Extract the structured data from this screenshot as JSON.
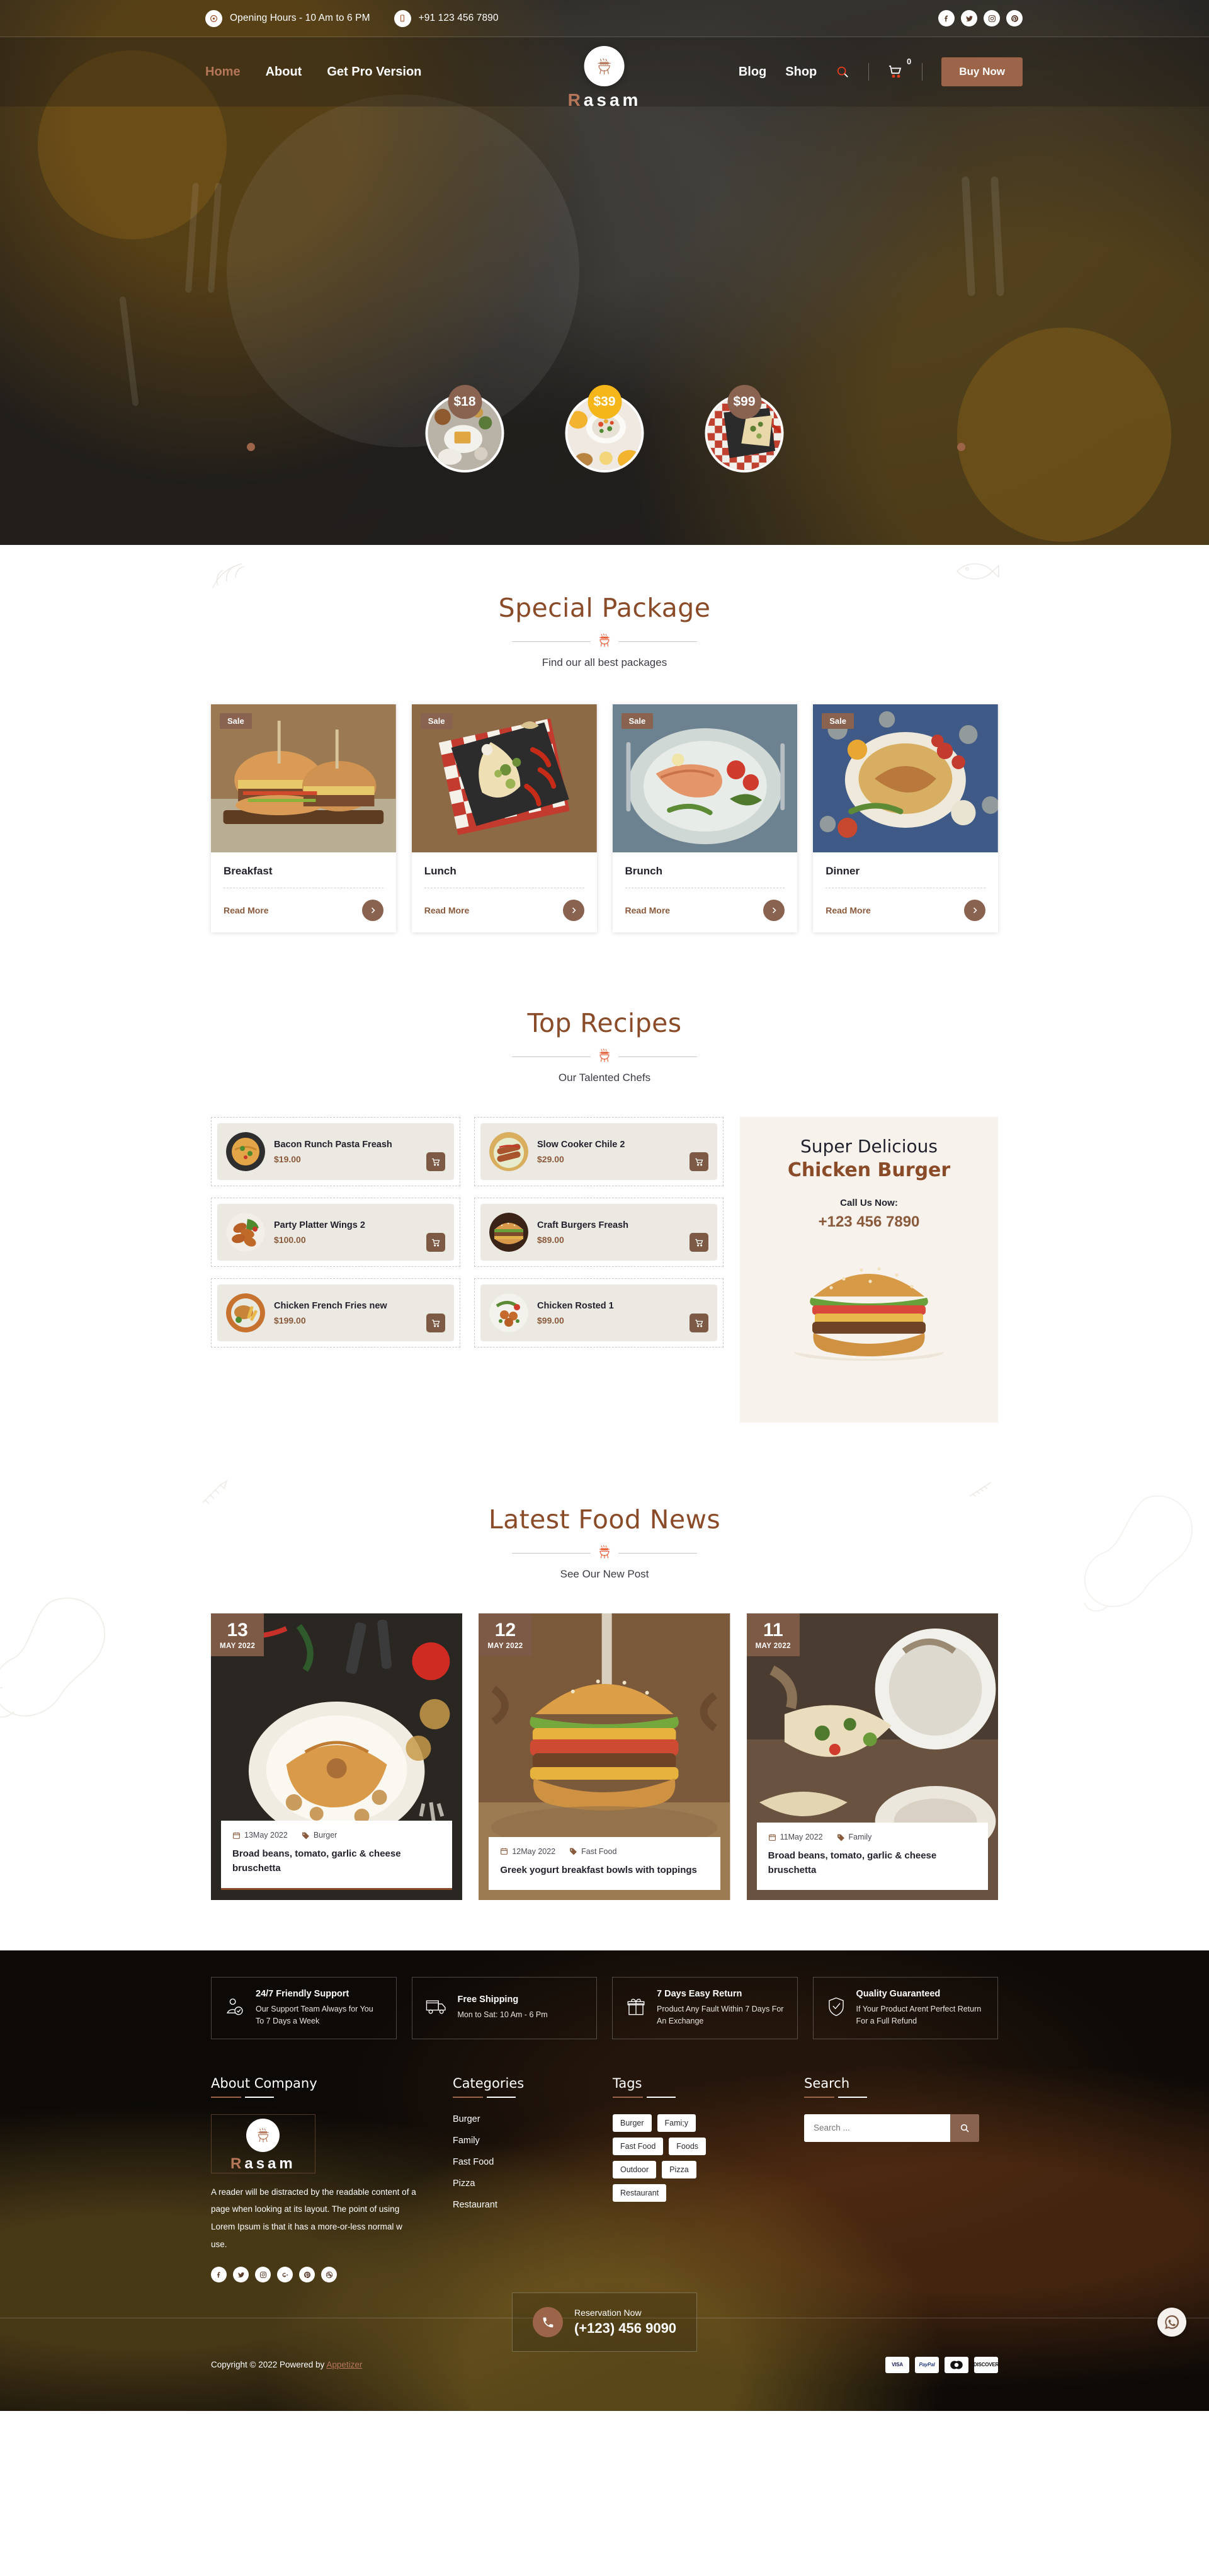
{
  "topbar": {
    "opening_hours": "Opening Hours - 10 Am to 6 PM",
    "phone": "+91 123 456 7890",
    "socials": [
      {
        "name": "facebook-icon",
        "label": "Facebook"
      },
      {
        "name": "twitter-icon",
        "label": "Twitter"
      },
      {
        "name": "instagram-icon",
        "label": "Instagram"
      },
      {
        "name": "pinterest-icon",
        "label": "Pinterest"
      }
    ]
  },
  "nav": {
    "left_links": [
      "Home",
      "About",
      "Get Pro Version"
    ],
    "right_links": [
      "Blog",
      "Shop"
    ],
    "cart_count": "0",
    "buy_now": "Buy Now",
    "brand": {
      "first_letter": "R",
      "rest": "asam",
      "full": "Rasam"
    }
  },
  "hero": {
    "circles": [
      {
        "price": "$18",
        "highlight": false
      },
      {
        "price": "$39",
        "highlight": true
      },
      {
        "price": "$99",
        "highlight": false
      }
    ]
  },
  "special": {
    "title": "Special Package",
    "subtitle": "Find our all best packages",
    "cards": [
      {
        "badge": "Sale",
        "title": "Breakfast",
        "link": "Read More"
      },
      {
        "badge": "Sale",
        "title": "Lunch",
        "link": "Read More"
      },
      {
        "badge": "Sale",
        "title": "Brunch",
        "link": "Read More"
      },
      {
        "badge": "Sale",
        "title": "Dinner",
        "link": "Read More"
      }
    ]
  },
  "recipes": {
    "title": "Top Recipes",
    "subtitle": "Our Talented Chefs",
    "items": [
      {
        "name": "Bacon Runch Pasta Freash",
        "price": "$19.00"
      },
      {
        "name": "Slow Cooker Chile 2",
        "price": "$29.00"
      },
      {
        "name": "Party Platter Wings 2",
        "price": "$100.00"
      },
      {
        "name": "Craft Burgers Freash",
        "price": "$89.00"
      },
      {
        "name": "Chicken French Fries new",
        "price": "$199.00"
      },
      {
        "name": "Chicken Rosted 1",
        "price": "$99.00"
      }
    ],
    "promo": {
      "line1": "Super Delicious",
      "line2": "Chicken Burger",
      "call_label": "Call Us Now:",
      "phone": "+123 456 7890"
    }
  },
  "news": {
    "title": "Latest Food News",
    "subtitle": "See Our New Post",
    "posts": [
      {
        "day": "13",
        "month_year": "MAY 2022",
        "date": "13May 2022",
        "tag": "Burger",
        "title": "Broad beans, tomato, garlic & cheese bruschetta"
      },
      {
        "day": "12",
        "month_year": "MAY 2022",
        "date": "12May 2022",
        "tag": "Fast Food",
        "title": "Greek yogurt breakfast bowls with toppings"
      },
      {
        "day": "11",
        "month_year": "MAY 2022",
        "date": "11May 2022",
        "tag": "Family",
        "title": "Broad beans, tomato, garlic & cheese bruschetta"
      }
    ]
  },
  "footer": {
    "features": [
      {
        "icon": "support-user-icon",
        "title": "24/7 Friendly Support",
        "desc": "Our Support Team Always for You To 7 Days a Week"
      },
      {
        "icon": "truck-icon",
        "title": "Free Shipping",
        "desc": "Mon to Sat: 10 Am - 6 Pm"
      },
      {
        "icon": "gift-box-icon",
        "title": "7 Days Easy Return",
        "desc": "Product Any Fault Within 7 Days For An Exchange"
      },
      {
        "icon": "shield-check-icon",
        "title": "Quality Guaranteed",
        "desc": "If Your Product Arent Perfect Return For a Full Refund"
      }
    ],
    "about": {
      "title": "About Company",
      "brand_first": "R",
      "brand_rest": "asam",
      "text": "A reader will be distracted by the readable content of a page when looking at its layout. The point of using Lorem Ipsum is that it has a more-or-less normal w use.",
      "socials": [
        "facebook-icon",
        "twitter-icon",
        "instagram-icon",
        "google-plus-icon",
        "pinterest-icon",
        "dribbble-icon"
      ]
    },
    "categories": {
      "title": "Categories",
      "items": [
        "Burger",
        "Family",
        "Fast Food",
        "Pizza",
        "Restaurant"
      ]
    },
    "tags": {
      "title": "Tags",
      "items": [
        "Burger",
        "Fami;y",
        "Fast Food",
        "Foods",
        "Outdoor",
        "Pizza",
        "Restaurant"
      ]
    },
    "search": {
      "title": "Search",
      "placeholder": "Search ..."
    },
    "bottom": {
      "copyright_prefix": "Copyright © 2022 Powered by ",
      "copyright_link": "Appetizer",
      "reservation_label": "Reservation Now",
      "reservation_phone": "(+123) 456 9090",
      "payments": [
        "VISA",
        "PayPal",
        "MasterCard",
        "DISCOVER"
      ]
    }
  },
  "colors": {
    "accent_brown": "#8a6350",
    "accent_dark": "#8a4b28",
    "button": "#9c6448",
    "gold": "#f5b61a"
  }
}
